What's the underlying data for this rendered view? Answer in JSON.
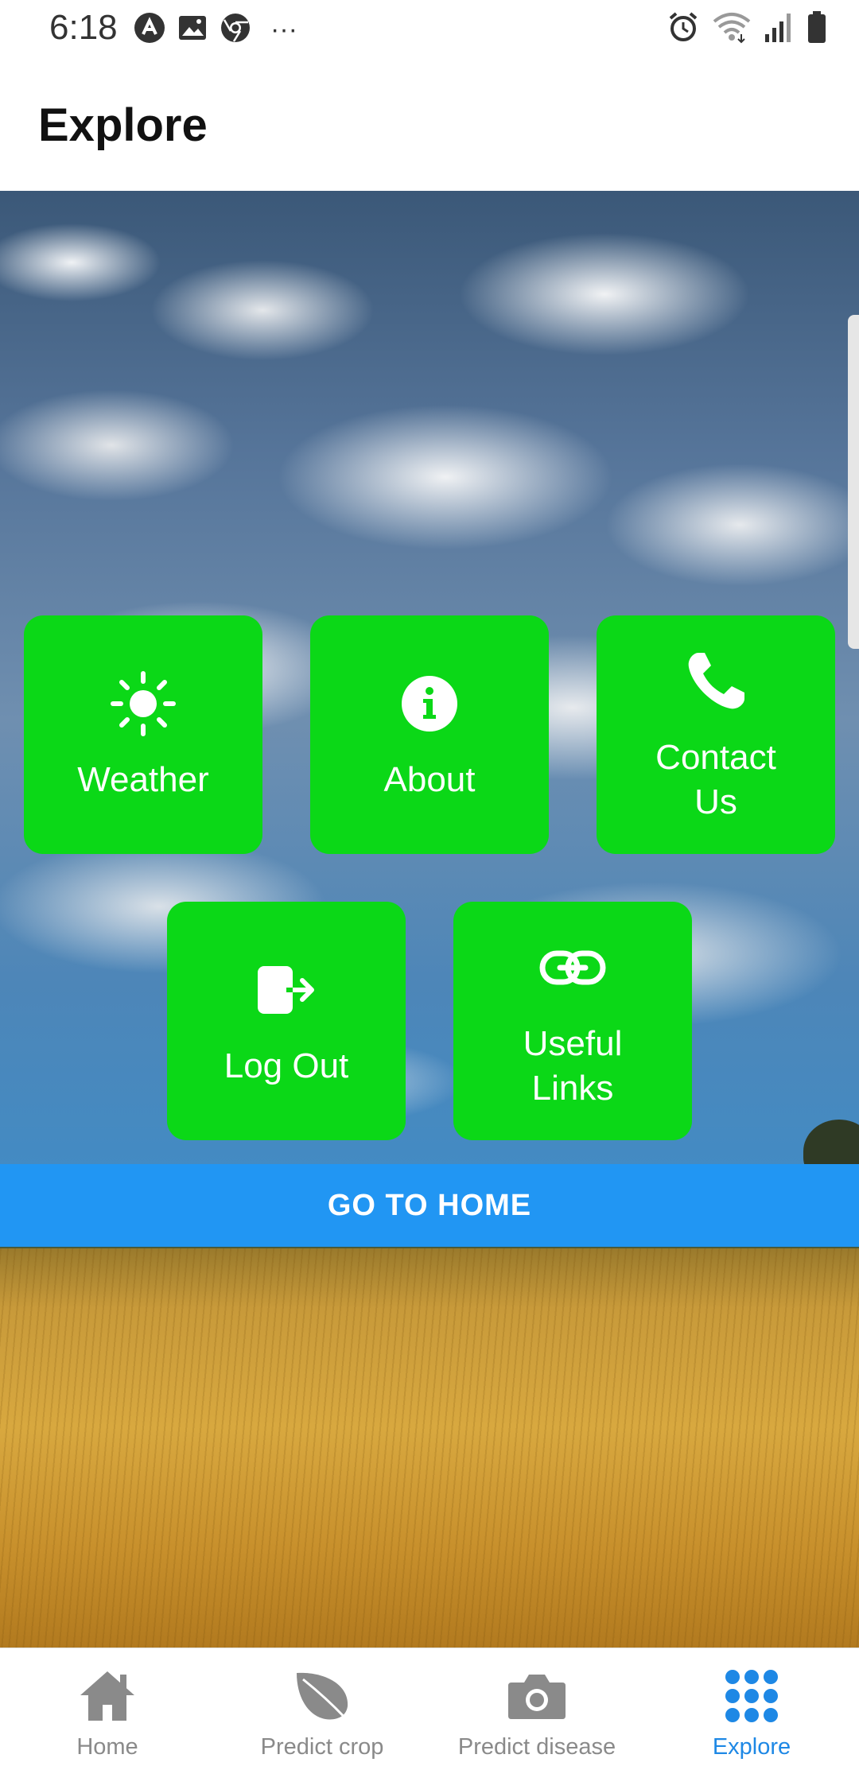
{
  "status_bar": {
    "time": "6:18",
    "left_icons": [
      "app-icon",
      "image-icon",
      "chrome-icon",
      "more-icon"
    ],
    "more_glyph": "···",
    "right_icons": [
      "alarm-icon",
      "wifi-icon",
      "signal-icon",
      "battery-icon"
    ]
  },
  "app_bar": {
    "title": "Explore"
  },
  "tiles": [
    {
      "label": "Weather",
      "icon": "sun-icon"
    },
    {
      "label": "About",
      "icon": "info-icon"
    },
    {
      "label": "Contact Us",
      "icon": "phone-icon"
    },
    {
      "label": "Log Out",
      "icon": "logout-icon"
    },
    {
      "label": "Useful Links",
      "icon": "link-icon"
    }
  ],
  "go_home": {
    "label": "GO TO HOME"
  },
  "bottom_nav": {
    "items": [
      {
        "label": "Home",
        "icon": "home-icon",
        "active": false
      },
      {
        "label": "Predict crop",
        "icon": "leaf-icon",
        "active": false
      },
      {
        "label": "Predict disease",
        "icon": "camera-icon",
        "active": false
      },
      {
        "label": "Explore",
        "icon": "grid-dots-icon",
        "active": true
      }
    ]
  },
  "colors": {
    "tile_green": "#0bd817",
    "button_blue": "#2196f3",
    "nav_active": "#1e88e5",
    "nav_inactive": "#8a8a8a"
  }
}
